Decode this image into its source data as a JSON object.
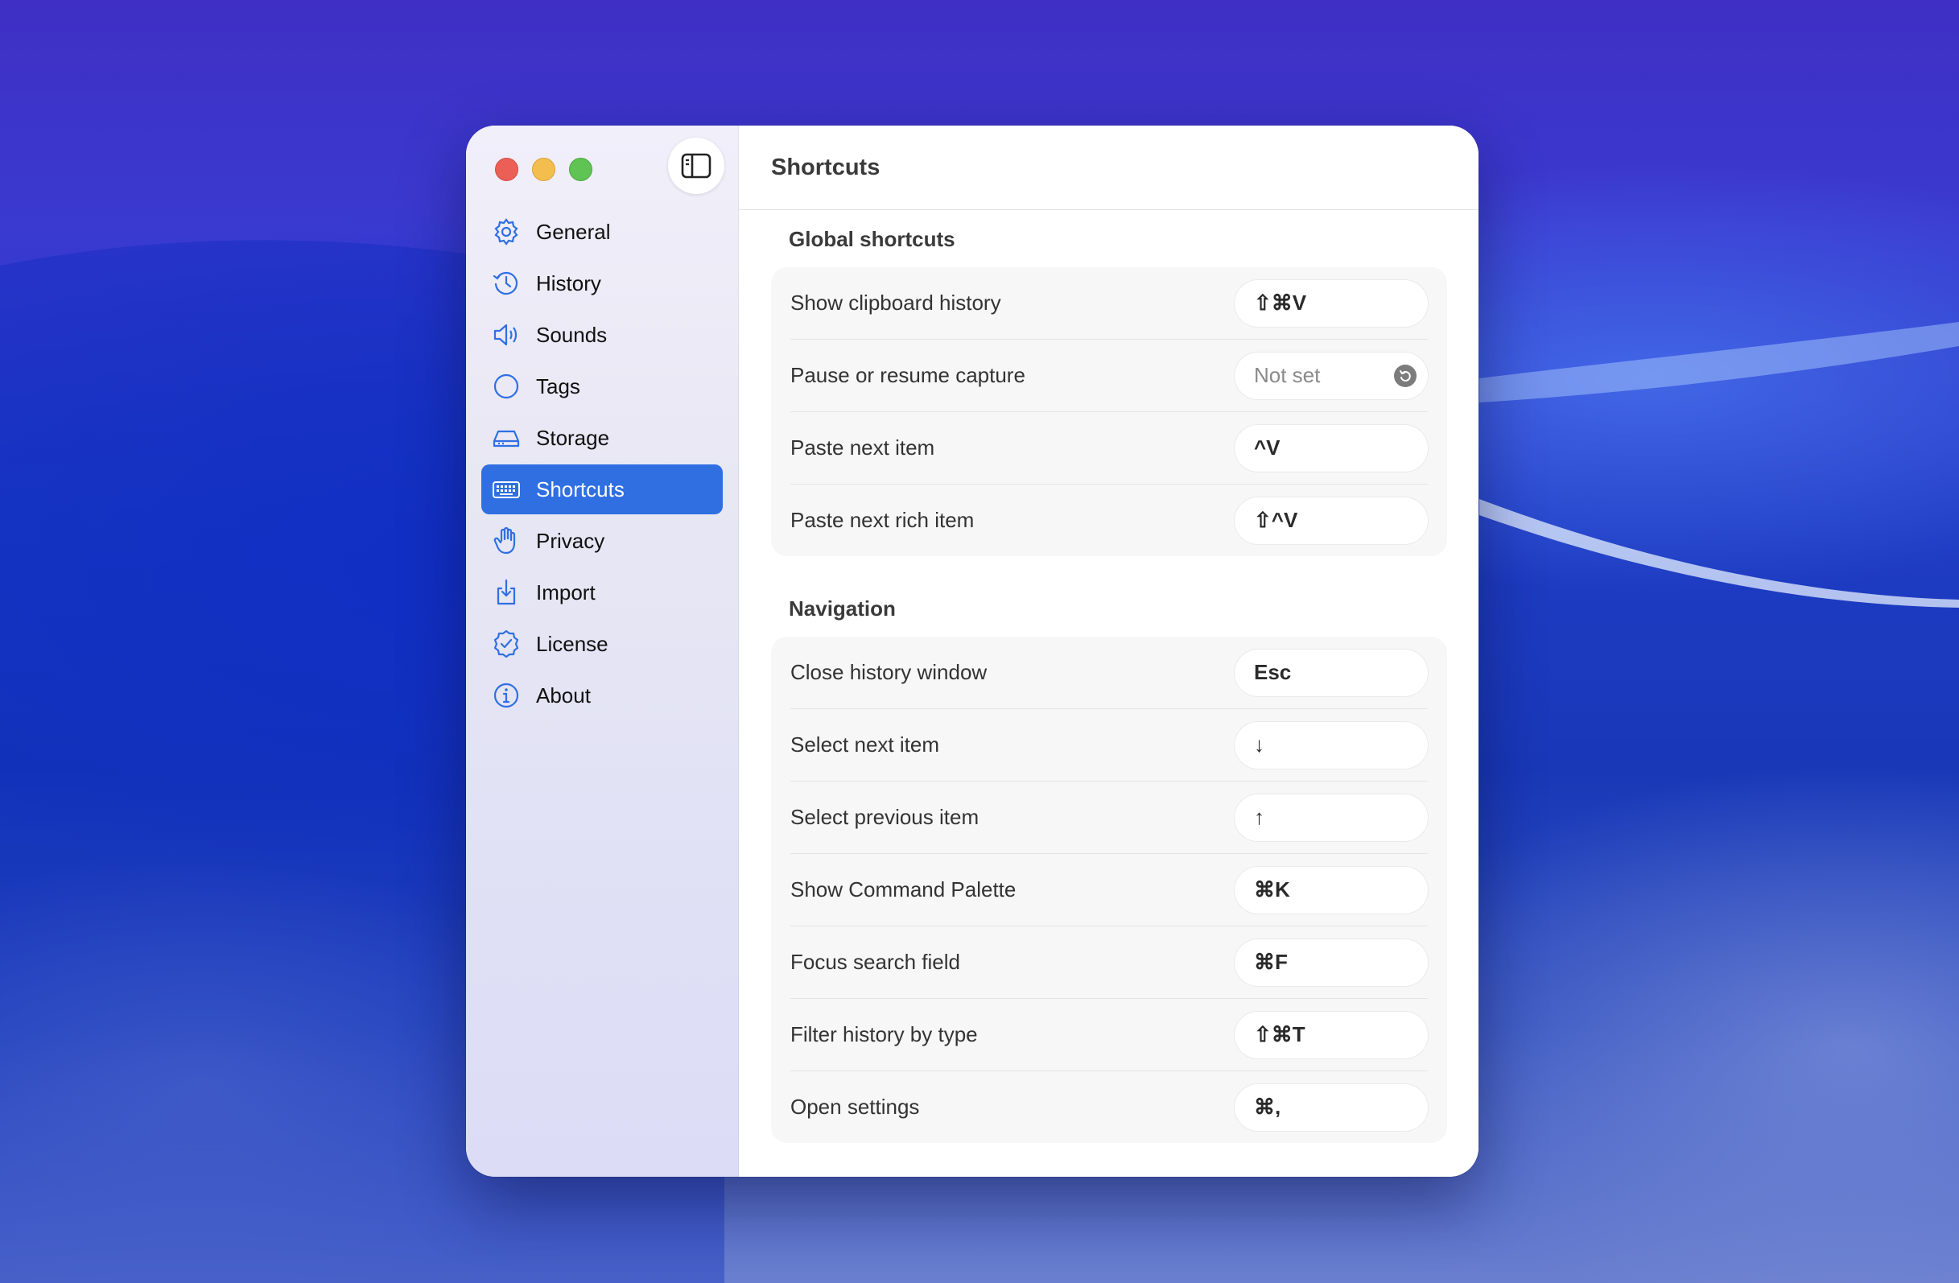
{
  "window": {
    "title": "Shortcuts"
  },
  "sidebar": {
    "items": [
      {
        "label": "General",
        "icon": "gear-icon"
      },
      {
        "label": "History",
        "icon": "clock-history-icon"
      },
      {
        "label": "Sounds",
        "icon": "speaker-icon"
      },
      {
        "label": "Tags",
        "icon": "circle-tag-icon"
      },
      {
        "label": "Storage",
        "icon": "drive-icon"
      },
      {
        "label": "Shortcuts",
        "icon": "keyboard-icon",
        "selected": true
      },
      {
        "label": "Privacy",
        "icon": "hand-icon"
      },
      {
        "label": "Import",
        "icon": "import-icon"
      },
      {
        "label": "License",
        "icon": "checkmark-seal-icon"
      },
      {
        "label": "About",
        "icon": "info-icon"
      }
    ]
  },
  "global_shortcuts": {
    "title": "Global shortcuts",
    "rows": [
      {
        "label": "Show clipboard history",
        "keys": "⇧⌘V"
      },
      {
        "label": "Pause or resume capture",
        "keys": "Not set"
      },
      {
        "label": "Paste next item",
        "keys": "^V"
      },
      {
        "label": "Paste next rich item",
        "keys": "⇧^V"
      }
    ]
  },
  "navigation": {
    "title": "Navigation",
    "rows": [
      {
        "label": "Close history window",
        "keys": "Esc"
      },
      {
        "label": "Select next item",
        "keys": "↓"
      },
      {
        "label": "Select previous item",
        "keys": "↑"
      },
      {
        "label": "Show Command Palette",
        "keys": "⌘K"
      },
      {
        "label": "Focus search field",
        "keys": "⌘F"
      },
      {
        "label": "Filter history by type",
        "keys": "⇧⌘T"
      },
      {
        "label": "Open settings",
        "keys": "⌘,"
      }
    ]
  },
  "colors": {
    "accent": "#2f6fe2",
    "icon_blue": "#2f6fe2"
  }
}
